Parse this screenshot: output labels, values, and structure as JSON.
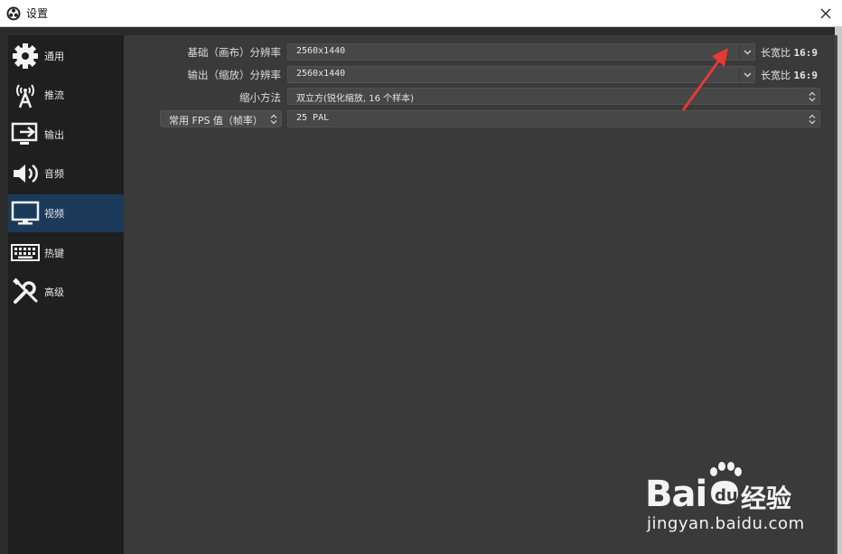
{
  "window": {
    "title": "设置",
    "close_icon": "close-icon"
  },
  "sidebar": {
    "items": [
      {
        "label": "通用",
        "icon": "gear-icon"
      },
      {
        "label": "推流",
        "icon": "broadcast-antenna-icon"
      },
      {
        "label": "输出",
        "icon": "output-monitor-icon"
      },
      {
        "label": "音频",
        "icon": "speaker-icon"
      },
      {
        "label": "视频",
        "icon": "monitor-icon",
        "active": true
      },
      {
        "label": "热键",
        "icon": "keyboard-icon"
      },
      {
        "label": "高级",
        "icon": "wrench-screwdriver-icon"
      }
    ]
  },
  "video": {
    "base_label": "基础（画布）分辨率",
    "base_value": "2560x1440",
    "base_aspect_label": "长宽比",
    "base_aspect_value": "16:9",
    "output_label": "输出（缩放）分辨率",
    "output_value": "2560x1440",
    "output_aspect_label": "长宽比",
    "output_aspect_value": "16:9",
    "downscale_label": "缩小方法",
    "downscale_value": "双立方(锐化缩放, 16 个样本)",
    "fps_type_label": "常用 FPS 值（帧率）",
    "fps_value": "25 PAL"
  },
  "watermark": {
    "brand": "Bai",
    "brand_suffix": "经验",
    "url": "jingyan.baidu.com"
  },
  "colors": {
    "accent_active": "#1b3a5a",
    "arrow": "#e53935"
  }
}
